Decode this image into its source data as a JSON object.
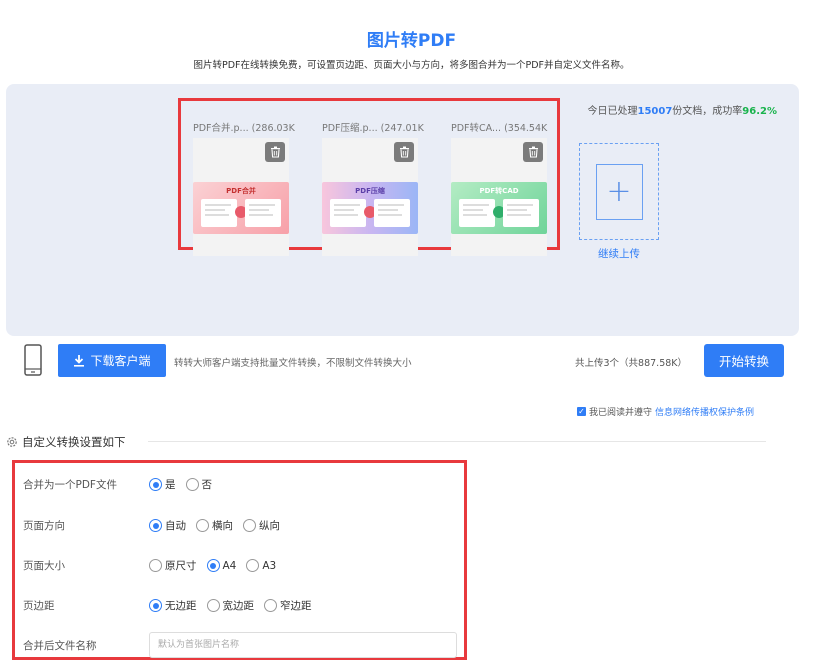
{
  "header": {
    "title": "图片转PDF",
    "subtitle": "图片转PDF在线转换免费，可设置页边距、页面大小与方向，将多图合并为一个PDF并自定义文件名称。"
  },
  "stats": {
    "prefix": "今日已处理",
    "count": "15007",
    "mid": "份文档，成功率",
    "rate": "96.2%"
  },
  "files": [
    {
      "name": "PDF合并.p...",
      "size": "(286.03K",
      "thumb_title": "PDF合并",
      "colors": [
        "#fbd1d4",
        "#f7a0a8",
        "#e85a6a"
      ]
    },
    {
      "name": "PDF压缩.p...",
      "size": "(247.01K",
      "thumb_title": "PDF压缩",
      "colors": [
        "#f8c6dc",
        "#c9b6f1",
        "#9bb6f6"
      ]
    },
    {
      "name": "PDF转CA...",
      "size": "(354.54K",
      "thumb_title": "PDF转CAD",
      "colors": [
        "#b4ecc4",
        "#6fd49a",
        "#2fae6a"
      ]
    }
  ],
  "upload": {
    "add_label": "继续上传",
    "add_symbol": "+"
  },
  "actions": {
    "download_label": "下载客户端",
    "download_note": "转转大师客户端支持批量文件转换，不限制文件转换大小",
    "total": "共上传3个（共887.58K）",
    "start_label": "开始转换"
  },
  "agreement": {
    "text": "我已阅读并遵守",
    "link": "信息网络传播权保护条例"
  },
  "settings": {
    "heading": "自定义转换设置如下",
    "rows": [
      {
        "label": "合并为一个PDF文件",
        "options": [
          "是",
          "否"
        ],
        "selected": 0
      },
      {
        "label": "页面方向",
        "options": [
          "自动",
          "横向",
          "纵向"
        ],
        "selected": 0
      },
      {
        "label": "页面大小",
        "options": [
          "原尺寸",
          "A4",
          "A3"
        ],
        "selected": 1
      },
      {
        "label": "页边距",
        "options": [
          "无边距",
          "宽边距",
          "窄边距"
        ],
        "selected": 0
      }
    ],
    "filename_label": "合并后文件名称",
    "filename_placeholder": "默认为首张图片名称"
  },
  "colors": {
    "accent": "#2f7df6",
    "success": "#1ab34d",
    "highlight": "#e8393d"
  }
}
